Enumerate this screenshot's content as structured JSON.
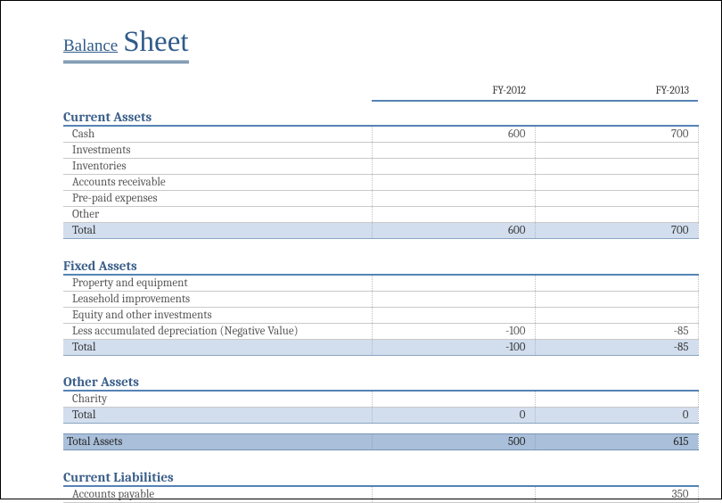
{
  "title": {
    "small": "Balance",
    "big": "Sheet"
  },
  "columns": [
    "FY-2012",
    "FY-2013"
  ],
  "sections": [
    {
      "name": "Current Assets",
      "items": [
        {
          "label": "Cash",
          "v1": "600",
          "v2": "700"
        },
        {
          "label": "Investments",
          "v1": "",
          "v2": ""
        },
        {
          "label": "Inventories",
          "v1": "",
          "v2": ""
        },
        {
          "label": "Accounts receivable",
          "v1": "",
          "v2": ""
        },
        {
          "label": "Pre-paid expenses",
          "v1": "",
          "v2": ""
        },
        {
          "label": "Other",
          "v1": "",
          "v2": ""
        }
      ],
      "total": {
        "label": "Total",
        "v1": "600",
        "v2": "700"
      }
    },
    {
      "name": "Fixed Assets",
      "items": [
        {
          "label": "Property and equipment",
          "v1": "",
          "v2": ""
        },
        {
          "label": "Leasehold improvements",
          "v1": "",
          "v2": ""
        },
        {
          "label": "Equity and other investments",
          "v1": "",
          "v2": ""
        },
        {
          "label": "Less accumulated depreciation (Negative Value)",
          "v1": "-100",
          "v2": "-85"
        }
      ],
      "total": {
        "label": "Total",
        "v1": "-100",
        "v2": "-85"
      }
    },
    {
      "name": "Other Assets",
      "items": [
        {
          "label": "Charity",
          "v1": "",
          "v2": ""
        }
      ],
      "total": {
        "label": "Total",
        "v1": "0",
        "v2": "0"
      }
    }
  ],
  "grand": {
    "label": "Total Assets",
    "v1": "500",
    "v2": "615"
  },
  "liabilities": {
    "name": "Current Liabilities",
    "items": [
      {
        "label": "Accounts payable",
        "v1": "",
        "v2": "350"
      }
    ]
  }
}
